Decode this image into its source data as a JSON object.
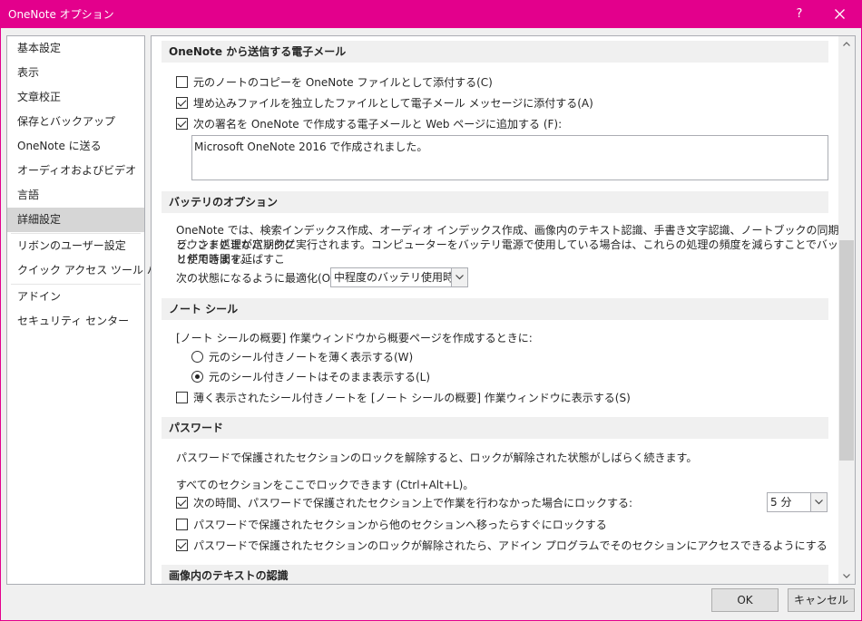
{
  "window": {
    "title": "OneNote オプション",
    "help": "?",
    "accent": "#e3008c"
  },
  "sidebar": {
    "items": [
      {
        "label": "基本設定"
      },
      {
        "label": "表示"
      },
      {
        "label": "文章校正"
      },
      {
        "label": "保存とバックアップ"
      },
      {
        "label": "OneNote に送る"
      },
      {
        "label": "オーディオおよびビデオ"
      },
      {
        "label": "言語"
      },
      {
        "label": "詳細設定",
        "selected": true
      },
      {
        "label": "リボンのユーザー設定"
      },
      {
        "label": "クイック アクセス ツール バー"
      },
      {
        "label": "アドイン"
      },
      {
        "label": "セキュリティ センター"
      }
    ]
  },
  "email": {
    "header": "OneNote から送信する電子メール",
    "opt_copy": {
      "label": "元のノートのコピーを OneNote ファイルとして添付する(C)",
      "checked": false
    },
    "opt_embed": {
      "label": "埋め込みファイルを独立したファイルとして電子メール メッセージに添付する(A)",
      "checked": true
    },
    "opt_sig": {
      "label": "次の署名を OneNote で作成する電子メールと Web ページに追加する (F):",
      "checked": true
    },
    "signature": "Microsoft OneNote 2016 で作成されました。"
  },
  "battery": {
    "header": "バッテリのオプション",
    "description_line1": "OneNote では、検索インデックス作成、オーディオ インデックス作成、画像内のテキスト認識、手書き文字認識、ノートブックの同期など、さまざまなバックグ",
    "description_line2": "ラウンド処理が定期的に実行されます。コンピューターをバッテリ電源で使用している場合は、これらの処理の頻度を減らすことでバッテリ使用時間を延ばすこ",
    "description_line3": "とができます。",
    "optimize_label": "次の状態になるように最適化(O):",
    "optimize_value": "中程度のバッテリ使用時間"
  },
  "tags": {
    "header": "ノート シール",
    "intro": "[ノート シールの概要] 作業ウィンドウから概要ページを作成するときに:",
    "radio_dim": {
      "label": "元のシール付きノートを薄く表示する(W)",
      "selected": false
    },
    "radio_keep": {
      "label": "元のシール付きノートはそのまま表示する(L)",
      "selected": true
    },
    "opt_show_dimmed": {
      "label": "薄く表示されたシール付きノートを [ノート シールの概要] 作業ウィンドウに表示する(S)",
      "checked": false
    }
  },
  "password": {
    "header": "パスワード",
    "intro": "パスワードで保護されたセクションのロックを解除すると、ロックが解除された状態がしばらく続きます。",
    "lock_all": "すべてのセクションをここでロックできます (Ctrl+Alt+L)。",
    "opt_timeout": {
      "label": "次の時間、パスワードで保護されたセクション上で作業を行わなかった場合にロックする:",
      "checked": true
    },
    "timeout_value": "5 分",
    "opt_leave": {
      "label": "パスワードで保護されたセクションから他のセクションへ移ったらすぐにロックする",
      "checked": false
    },
    "opt_addins": {
      "label": "パスワードで保護されたセクションのロックが解除されたら、アドイン プログラムでそのセクションにアクセスできるようにする",
      "checked": true
    }
  },
  "ocr": {
    "header": "画像内のテキストの認識"
  },
  "buttons": {
    "ok": "OK",
    "cancel": "キャンセル"
  }
}
